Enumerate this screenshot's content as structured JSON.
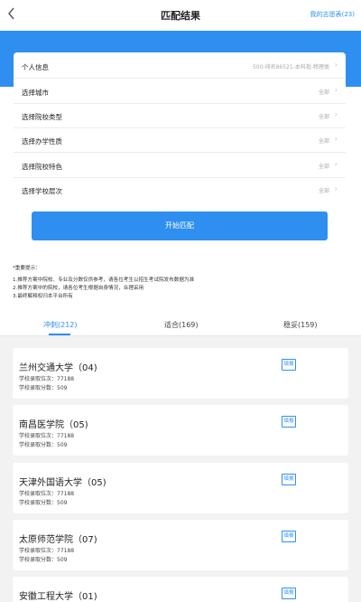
{
  "header": {
    "back_icon": "chevron-left-icon",
    "title": "匹配结果",
    "my_list": "我的志愿表(23)"
  },
  "form": {
    "rows": [
      {
        "label": "个人信息",
        "value": "500-排名86521-本科批-物理类"
      },
      {
        "label": "选择城市",
        "value": "全部"
      },
      {
        "label": "选择院校类型",
        "value": "全部"
      },
      {
        "label": "选择办学性质",
        "value": "全部"
      },
      {
        "label": "选择院校特色",
        "value": "全部"
      },
      {
        "label": "选择学校层次",
        "value": "全部"
      }
    ],
    "start_button": "开始匹配"
  },
  "notes": {
    "title": "*重要提示：",
    "items": [
      "1.推荐方案中院校、专业及分数仅供参考，请各位考生以招生考试院发布数据为准",
      "2.推荐方案中的院校，请各位考生根据自身情况，合理采用",
      "3.最终解释权归本平台所有"
    ]
  },
  "tabs": [
    {
      "label": "冲刺(212)",
      "active": true
    },
    {
      "label": "适合(169)",
      "active": false
    },
    {
      "label": "稳妥(159)",
      "active": false
    }
  ],
  "schools": [
    {
      "name": "兰州交通大学（04)",
      "rank": "学校录取位次：77188",
      "score": "学校录取分数：509",
      "button": "填报"
    },
    {
      "name": "南昌医学院（05)",
      "rank": "学校录取位次：77188",
      "score": "学校录取分数：509",
      "button": "填报"
    },
    {
      "name": "天津外国语大学（05)",
      "rank": "学校录取位次：77188",
      "score": "学校录取分数：509",
      "button": "填报"
    },
    {
      "name": "太原师范学院（07)",
      "rank": "学校录取位次：77188",
      "score": "学校录取分数：509",
      "button": "填报"
    },
    {
      "name": "安徽工程大学（01)",
      "rank": "",
      "score": "",
      "button": "填报"
    }
  ],
  "colors": {
    "accent": "#2f8ff0",
    "list_bg": "#f2f2f2"
  }
}
